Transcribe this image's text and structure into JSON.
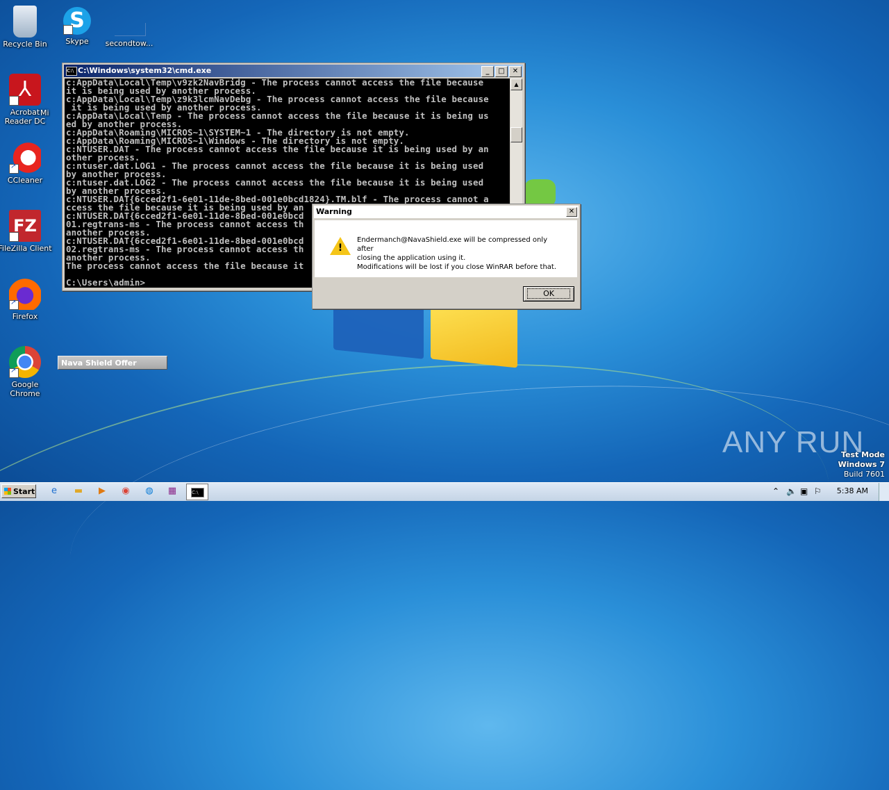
{
  "desktop": {
    "icons": [
      {
        "label": "Recycle Bin",
        "icon": "recycle-bin-icon"
      },
      {
        "label": "Skype",
        "icon": "skype-icon"
      },
      {
        "label": "secondtow...",
        "icon": "file-icon"
      },
      {
        "label": "Acrobat Reader DC",
        "icon": "acrobat-icon"
      },
      {
        "label": "CCleaner",
        "icon": "ccleaner-icon"
      },
      {
        "label": "FileZilla Client",
        "icon": "filezilla-icon"
      },
      {
        "label": "Firefox",
        "icon": "firefox-icon"
      },
      {
        "label": "Google Chrome",
        "icon": "chrome-icon"
      }
    ],
    "partial_label": "Mi"
  },
  "cmd": {
    "title": "C:\\Windows\\system32\\cmd.exe",
    "icon_text": "C:\\",
    "output": "c:AppData\\Local\\Temp\\v9zk2NavBridg - The process cannot access the file because\nit is being used by another process.\nc:AppData\\Local\\Temp\\z9k3lcmNavDebg - The process cannot access the file because\n it is being used by another process.\nc:AppData\\Local\\Temp - The process cannot access the file because it is being us\ned by another process.\nc:AppData\\Roaming\\MICROS~1\\SYSTEM~1 - The directory is not empty.\nc:AppData\\Roaming\\MICROS~1\\Windows - The directory is not empty.\nc:NTUSER.DAT - The process cannot access the file because it is being used by an\nother process.\nc:ntuser.dat.LOG1 - The process cannot access the file because it is being used\nby another process.\nc:ntuser.dat.LOG2 - The process cannot access the file because it is being used\nby another process.\nc:NTUSER.DAT{6cced2f1-6e01-11de-8bed-001e0bcd1824}.TM.blf - The process cannot a\nccess the file because it is being used by an\nc:NTUSER.DAT{6cced2f1-6e01-11de-8bed-001e0bcd\n01.regtrans-ms - The process cannot access th\nanother process.\nc:NTUSER.DAT{6cced2f1-6e01-11de-8bed-001e0bcd\n02.regtrans-ms - The process cannot access th\nanother process.\nThe process cannot access the file because it\n\nC:\\Users\\admin>"
  },
  "warning_dialog": {
    "title": "Warning",
    "line1": "Endermanch@NavaShield.exe will be compressed only after",
    "line2": "closing the application using it.",
    "line3": "Modifications will be lost if you close WinRAR before that.",
    "ok_label": "OK"
  },
  "nava_button": "Nava Shield Offer",
  "watermark": "ANY RUN",
  "test_mode": {
    "line1": "Test Mode",
    "line2": "Windows 7",
    "line3": "Build 7601"
  },
  "taskbar": {
    "start_label": "Start",
    "clock": "5:38 AM"
  }
}
